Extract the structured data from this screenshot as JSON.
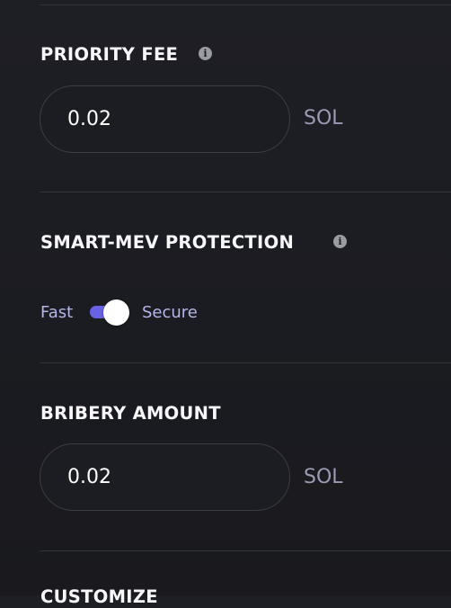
{
  "settings": {
    "priority_fee": {
      "title": "PRIORITY FEE",
      "info_icon": "info-icon",
      "value": "0.02",
      "unit": "SOL"
    },
    "smart_mev": {
      "title": "SMART-MEV PROTECTION",
      "info_icon": "info-icon",
      "left_label": "Fast",
      "right_label": "Secure",
      "selected": "Secure",
      "toggle_color": "#6a62e4"
    },
    "bribery_amount": {
      "title": "BRIBERY AMOUNT",
      "value": "0.02",
      "unit": "SOL"
    },
    "next_section": {
      "title": "CUSTOMIZE"
    }
  },
  "colors": {
    "background": "#1c1d22",
    "accent": "#6a62e4",
    "unit_text": "#9a9ab3",
    "toggle_label_text": "#b3b6e9"
  }
}
